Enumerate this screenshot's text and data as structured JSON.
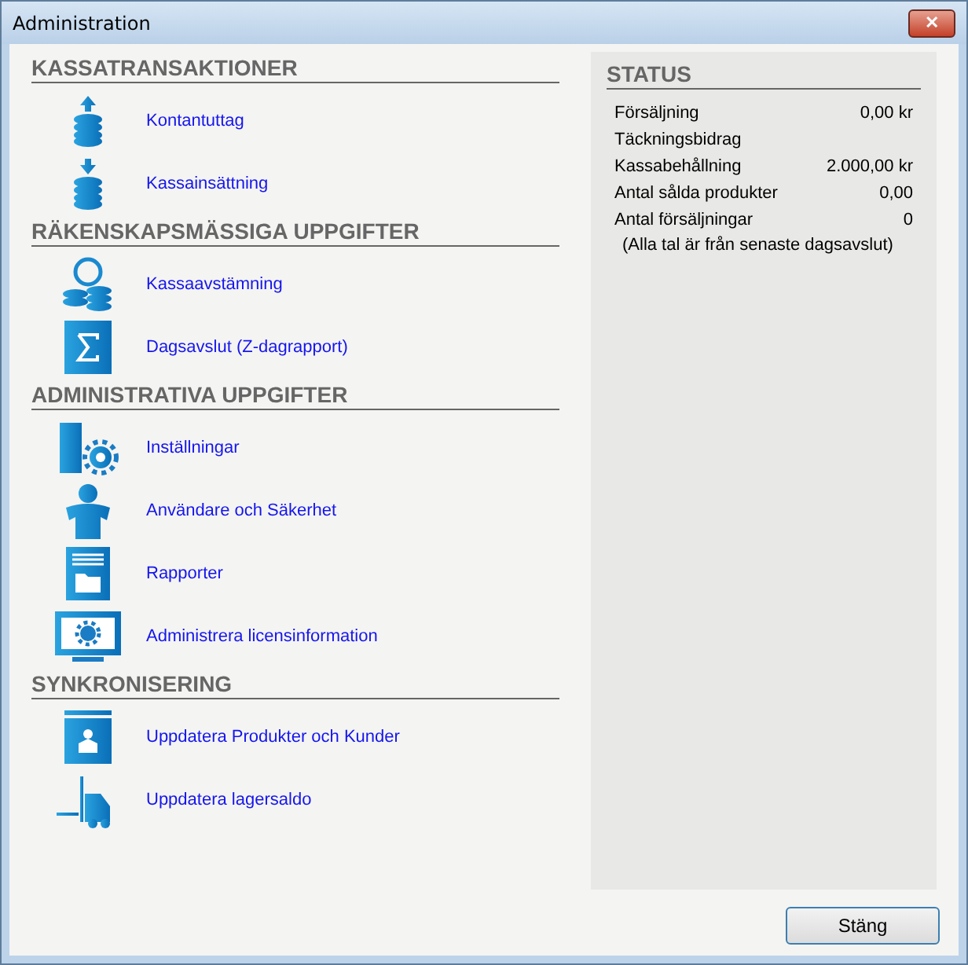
{
  "window": {
    "title": "Administration",
    "close": "✕"
  },
  "sections": [
    {
      "title": "KASSATRANSAKTIONER",
      "items": [
        {
          "kind": "withdraw",
          "label": "Kontantuttag"
        },
        {
          "kind": "deposit",
          "label": "Kassainsättning"
        }
      ]
    },
    {
      "title": "RÄKENSKAPSMÄSSIGA UPPGIFTER",
      "items": [
        {
          "kind": "reconcile",
          "label": "Kassaavstämning"
        },
        {
          "kind": "sigma",
          "label": "Dagsavslut (Z-dagrapport)"
        }
      ]
    },
    {
      "title": "ADMINISTRATIVA UPPGIFTER",
      "items": [
        {
          "kind": "settings",
          "label": "Inställningar"
        },
        {
          "kind": "user",
          "label": "Användare och Säkerhet"
        },
        {
          "kind": "report",
          "label": "Rapporter"
        },
        {
          "kind": "license",
          "label": "Administrera licensinformation"
        }
      ]
    },
    {
      "title": "SYNKRONISERING",
      "items": [
        {
          "kind": "sync",
          "label": "Uppdatera Produkter och Kunder"
        },
        {
          "kind": "stock",
          "label": "Uppdatera lagersaldo"
        }
      ]
    }
  ],
  "status": {
    "title": "STATUS",
    "rows": [
      {
        "label": "Försäljning",
        "value": "0,00 kr"
      },
      {
        "label": "Täckningsbidrag"
      },
      {
        "label": "Kassabehållning",
        "value": "2.000,00 kr"
      },
      {
        "label": "Antal sålda produkter",
        "value": "0,00"
      },
      {
        "label": "Antal försäljningar",
        "value": "0"
      }
    ],
    "note": "(Alla tal är från senaste dagsavslut)"
  },
  "buttons": [
    "Stäng"
  ]
}
